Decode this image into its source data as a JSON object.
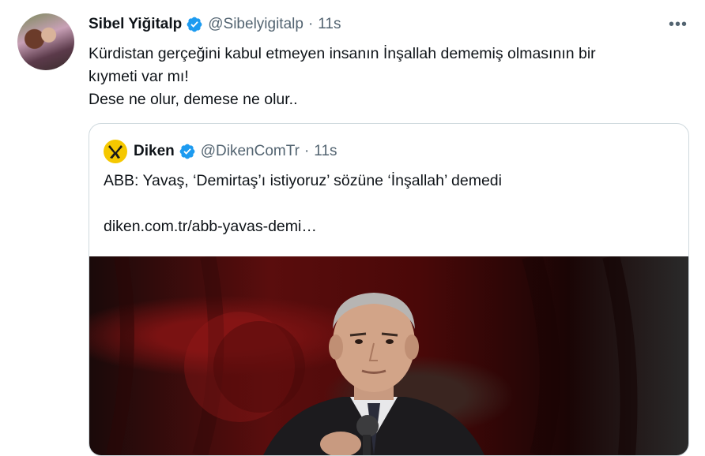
{
  "tweet": {
    "author_name": "Sibel Yiğitalp",
    "author_handle": "@Sibelyigitalp",
    "separator": "·",
    "time": "11s",
    "more": "•••",
    "text_lines": [
      "Kürdistan gerçeğini kabul etmeyen insanın İnşallah dememiş olmasının bir",
      "kıymeti var mı!",
      "Dese ne olur, demese ne olur.."
    ]
  },
  "quote": {
    "author_name": "Diken",
    "author_handle": "@DikenComTr",
    "separator": "·",
    "time": "11s",
    "text": "ABB: Yavaş, ‘Demirtaş’ı istiyoruz’ sözüne ‘İnşallah’ demedi",
    "link": "diken.com.tr/abb-yavas-demi…"
  },
  "colors": {
    "verified": "#1d9bf0",
    "muted": "#536471",
    "border": "#cfd9de",
    "diken_logo": "#f5c800"
  },
  "icons": {
    "verified": "verified-badge-icon",
    "more": "more-dots-icon",
    "logo": "diken-logo-icon"
  }
}
